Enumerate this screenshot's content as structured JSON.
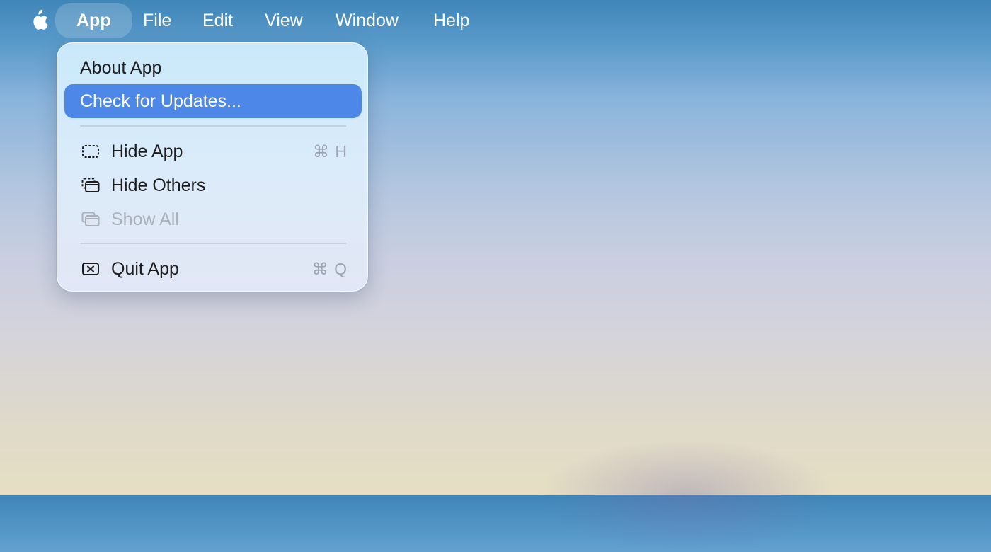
{
  "menubar": {
    "apple_icon": "apple-logo-icon",
    "menus": [
      {
        "label": "App",
        "active": true
      },
      {
        "label": "File"
      },
      {
        "label": "Edit"
      },
      {
        "label": "View"
      },
      {
        "label": "Window"
      },
      {
        "label": "Help"
      }
    ]
  },
  "app_menu": {
    "items": [
      {
        "label": "About App"
      },
      {
        "label": "Check for Updates...",
        "highlighted": true
      },
      {
        "label": "Hide App",
        "icon": "hide-window-icon",
        "shortcut": "⌘ H"
      },
      {
        "label": "Hide Others",
        "icon": "hide-others-icon"
      },
      {
        "label": "Show All",
        "icon": "show-all-icon",
        "disabled": true
      },
      {
        "label": "Quit App",
        "icon": "quit-icon",
        "shortcut": "⌘ Q"
      }
    ]
  },
  "colors": {
    "highlight": "#4d88e8",
    "menu_text": "#1d1d1f",
    "disabled_text": "#a9b0bc"
  }
}
